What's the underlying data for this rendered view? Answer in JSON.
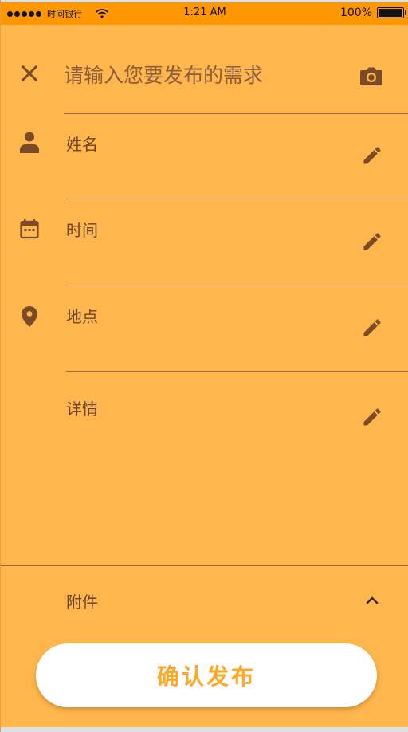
{
  "status_bar": {
    "carrier": "时间银行",
    "time": "1:21 AM",
    "battery_percent": "100%"
  },
  "header": {
    "title_placeholder": "请输入您要发布的需求",
    "close_icon": "close-icon",
    "camera_icon": "camera-icon"
  },
  "form": {
    "fields": [
      {
        "label": "姓名",
        "icon": "person-icon"
      },
      {
        "label": "时间",
        "icon": "calendar-icon"
      },
      {
        "label": "地点",
        "icon": "location-pin-icon"
      },
      {
        "label": "详情",
        "icon": ""
      }
    ]
  },
  "attachments": {
    "label": "附件",
    "icon": "chevron-up-icon"
  },
  "actions": {
    "confirm_label": "确认发布"
  },
  "colors": {
    "status_bar": "#ff9800",
    "background": "#ffb74d",
    "icon": "#7b4a27",
    "button_text": "#ffa726"
  }
}
